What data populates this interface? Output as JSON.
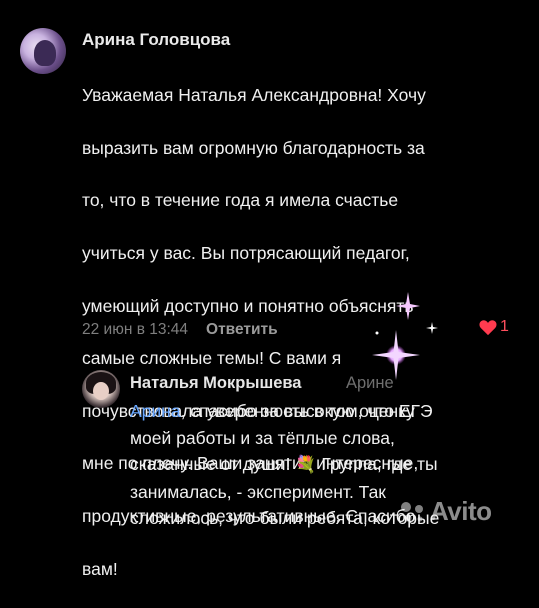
{
  "comment": {
    "author": "Арина Головцова",
    "text_lines": [
      "Уважаемая Наталья Александровна! Хочу",
      "выразить вам огромную благодарность за",
      "то, что в течение года я имела счастье",
      "учиться у вас. Вы потрясающий педагог,",
      "умеющий доступно и понятно объяснять",
      "самые сложные темы! С вами я",
      "почувствовала уверенность в том, что ЕГЭ",
      "мне по плечу.  Ваши занятия интересные,",
      "продуктивные, результативные. Спасибо",
      "вам!"
    ],
    "date": "22 июн в 13:44",
    "reply_label": "Ответить",
    "likes": "1",
    "like_color": "#ff3b4f"
  },
  "reply": {
    "author": "Наталья Мокрышева",
    "reply_to": "Арине",
    "mention": "Арина",
    "line1_rest": ", спасибо за высокую оценку",
    "line2": "моей работы и за тёплые слова,",
    "line3_a": "сказанные от души!",
    "emoji": "💐",
    "line3_b": "Группа, где ты",
    "line4": "занималась, - эксперимент. Так",
    "line5": "сложилось, что были ребята, которые"
  },
  "watermark": {
    "text": "Avito"
  },
  "colors": {
    "background": "#000000",
    "mention": "#6aa8ff",
    "muted": "#7f7f7f"
  }
}
